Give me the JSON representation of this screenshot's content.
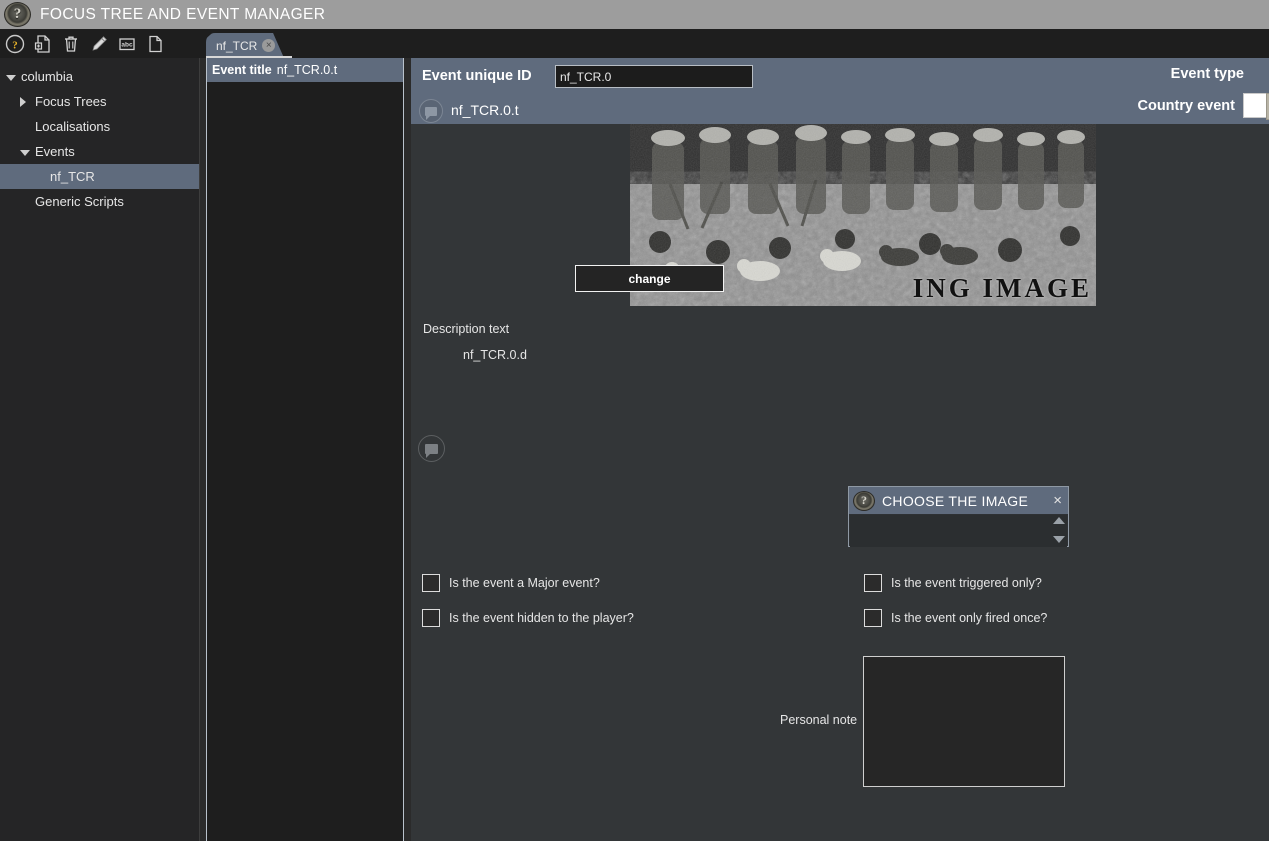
{
  "window": {
    "title": "FOCUS TREE AND EVENT MANAGER",
    "logo_icon": "wreath-question-mark-logo",
    "logo_glyph": "?"
  },
  "toolbar": {
    "items": [
      {
        "name": "help-icon",
        "label": "?"
      },
      {
        "name": "new-file-icon",
        "label": "New"
      },
      {
        "name": "delete-icon",
        "label": "Delete"
      },
      {
        "name": "edit-pencil-icon",
        "label": "Edit"
      },
      {
        "name": "localisation-abc-icon",
        "label": "abc"
      },
      {
        "name": "duplicate-page-icon",
        "label": "Duplicate"
      }
    ]
  },
  "tabs": [
    {
      "label": "nf_TCR",
      "close": "×",
      "active": true
    }
  ],
  "sidebar": {
    "items": [
      {
        "label": "columbia",
        "indent": 0,
        "arrow": "down",
        "selected": false
      },
      {
        "label": "Focus Trees",
        "indent": 1,
        "arrow": "right",
        "selected": false
      },
      {
        "label": "Localisations",
        "indent": 1,
        "arrow": "none",
        "selected": false
      },
      {
        "label": "Events",
        "indent": 1,
        "arrow": "down",
        "selected": false
      },
      {
        "label": "nf_TCR",
        "indent": 2,
        "arrow": "none",
        "selected": true
      },
      {
        "label": "Generic Scripts",
        "indent": 1,
        "arrow": "none",
        "selected": false
      }
    ]
  },
  "event_list": {
    "header_label": "Event title",
    "header_value": "nf_TCR.0.t"
  },
  "editor": {
    "unique_id_label": "Event unique ID",
    "unique_id_value": "nf_TCR.0",
    "unique_id_placeholder": "nf_TCR.0",
    "title_bubble_icon": "comment-bubble-icon",
    "title_value": "nf_TCR.0.t",
    "event_type_label": "Event type",
    "event_type_value": "Country event",
    "image": {
      "watermark": "ING  IMAGE",
      "alt": "black-and-white photo of soldiers marching with dogs",
      "change_button": "change"
    },
    "description_label": "Description text",
    "description_value": "nf_TCR.0.d",
    "description_bubble_icon": "comment-bubble-icon",
    "checkboxes": [
      {
        "label": "Is the event a Major event?",
        "checked": false,
        "name": "major-event-checkbox"
      },
      {
        "label": "Is the event triggered only?",
        "checked": false,
        "name": "triggered-only-checkbox"
      },
      {
        "label": "Is the event hidden to the player?",
        "checked": false,
        "name": "hidden-event-checkbox"
      },
      {
        "label": "Is the event only fired once?",
        "checked": false,
        "name": "fire-once-checkbox"
      }
    ],
    "personal_note_label": "Personal note",
    "personal_note_value": "",
    "personal_note_placeholder": ""
  },
  "dialog": {
    "title": "CHOOSE THE IMAGE",
    "close_label": "×",
    "logo_glyph": "?",
    "list_items": [],
    "scroll_up_icon": "chevron-up-icon",
    "scroll_down_icon": "chevron-down-icon"
  },
  "colors": {
    "titlebar": "#9d9d9d",
    "accent_slate": "#5f6b7d",
    "panel_dark": "#1e1e1e",
    "editor_bg": "#333638",
    "tree_bg": "#252526",
    "text": "#e6e6e6"
  }
}
